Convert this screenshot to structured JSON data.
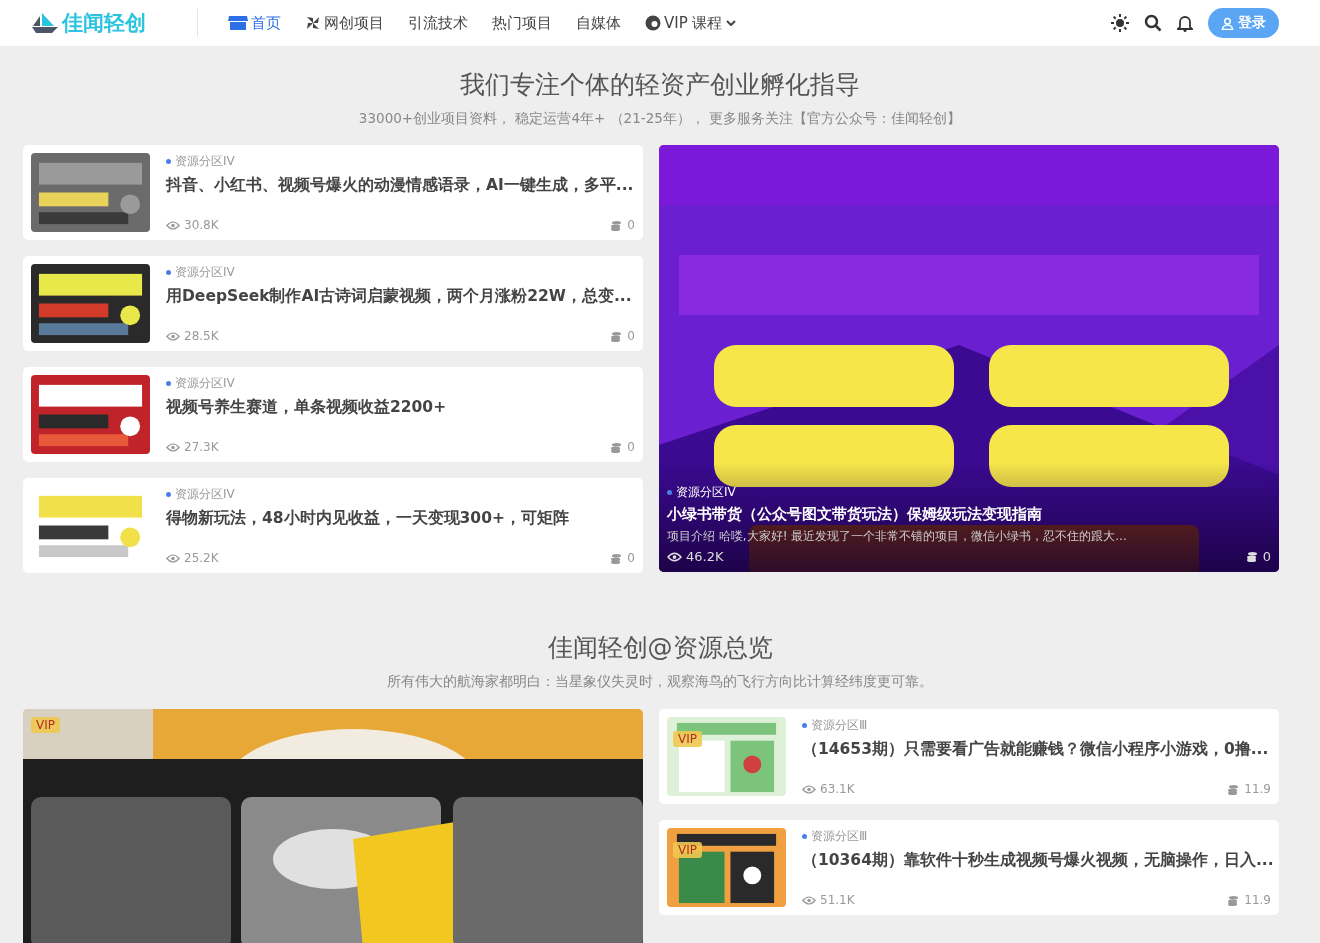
{
  "header": {
    "logo": "佳闻轻创",
    "nav": [
      {
        "label": "首页",
        "selected": true,
        "dropdown": false
      },
      {
        "label": "网创项目",
        "selected": false,
        "dropdown": false
      },
      {
        "label": "引流技术",
        "selected": false,
        "dropdown": false
      },
      {
        "label": "热门项目",
        "selected": false,
        "dropdown": false
      },
      {
        "label": "自媒体",
        "selected": false,
        "dropdown": false
      },
      {
        "label": "VIP 课程",
        "selected": false,
        "dropdown": true
      }
    ],
    "login": "登录"
  },
  "hero": {
    "title": "我们专注个体的轻资产创业孵化指导",
    "subtitle": "33000+创业项目资料， 稳定运营4年+ （21-25年）， 更多服务关注【官方公众号：佳闻轻创】"
  },
  "featured": [
    {
      "category": "资源分区IV",
      "title": "抖音、小红书、视频号爆火的动漫情感语录，AI一键生成，多平...",
      "views": "30.8K",
      "comments": "0"
    },
    {
      "category": "资源分区IV",
      "title": "用DeepSeek制作AI古诗词启蒙视频，两个月涨粉22W，总变...",
      "views": "28.5K",
      "comments": "0"
    },
    {
      "category": "资源分区IV",
      "title": "视频号养生赛道，单条视频收益2200+",
      "views": "27.3K",
      "comments": "0"
    },
    {
      "category": "资源分区IV",
      "title": "得物新玩法，48小时内见收益，一天变现300+，可矩阵",
      "views": "25.2K",
      "comments": "0"
    }
  ],
  "banner": {
    "category": "资源分区IV",
    "title": "小绿书带货（公众号图文带货玩法）保姆级玩法变现指南",
    "excerpt": "项目介绍 哈喽,大家好! 最近发现了一个非常不错的项目，微信小绿书，忍不住的跟大...",
    "views": "46.2K",
    "comments": "0"
  },
  "overview": {
    "title": "佳闻轻创@资源总览",
    "subtitle": "所有伟大的航海家都明白：当星象仪失灵时，观察海鸟的飞行方向比计算经纬度更可靠。",
    "big_card": {
      "badge": "VIP"
    },
    "items": [
      {
        "badge": "VIP",
        "category": "资源分区Ⅲ",
        "title": "（14653期）只需要看广告就能赚钱？微信小程序小游戏，0撸...",
        "views": "63.1K",
        "price": "11.9"
      },
      {
        "badge": "VIP",
        "category": "资源分区Ⅲ",
        "title": "（10364期）靠软件十秒生成视频号爆火视频，无脑操作，日入...",
        "views": "51.1K",
        "price": "11.9"
      }
    ]
  }
}
